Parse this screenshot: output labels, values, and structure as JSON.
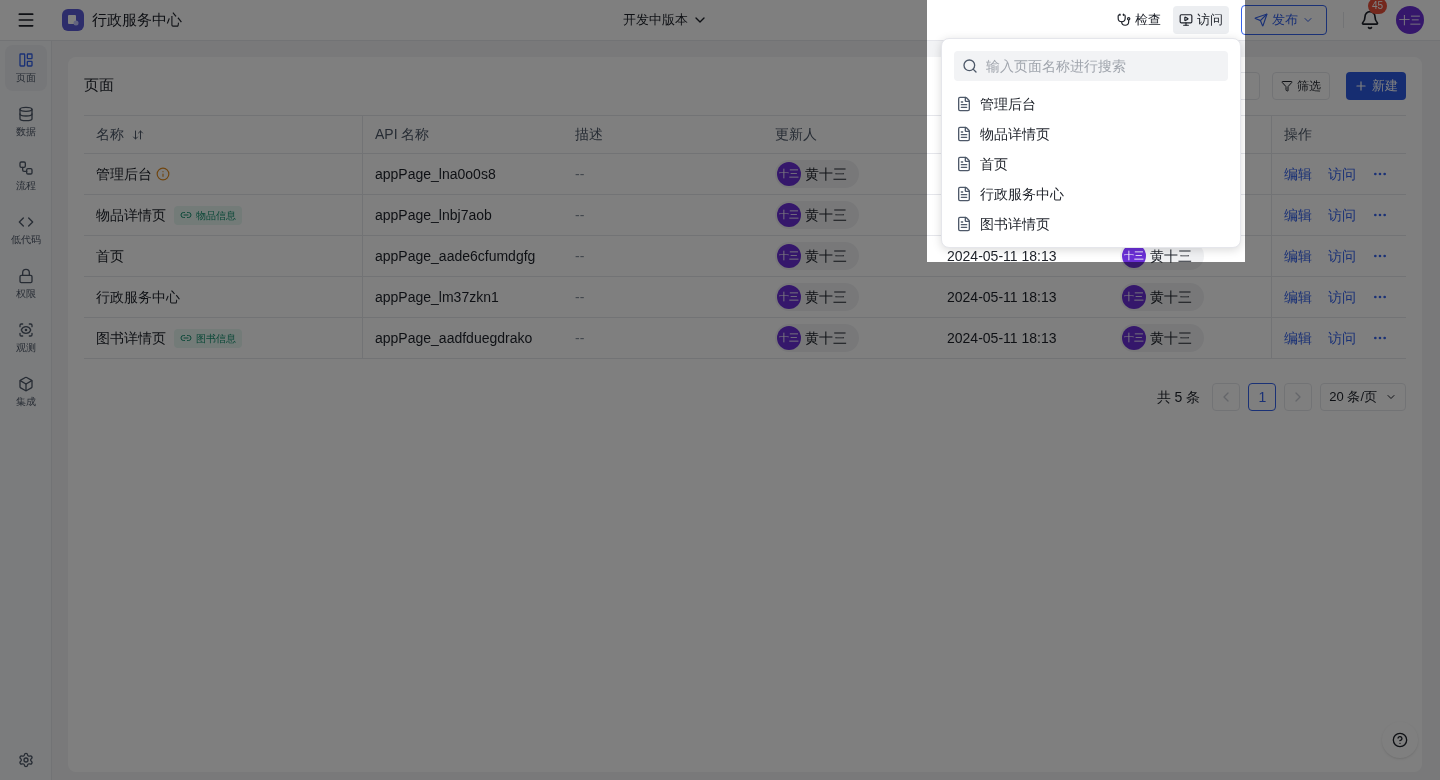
{
  "header": {
    "app_title": "行政服务中心",
    "version": "开发中版本",
    "inspect": "检查",
    "visit": {
      "label": "访问",
      "selected": true
    },
    "publish": "发布",
    "notifications": "45",
    "avatar": "十三"
  },
  "sidebar": {
    "items": [
      {
        "label": "页面",
        "selected": true
      },
      {
        "label": "数据",
        "selected": false
      },
      {
        "label": "流程",
        "selected": false
      },
      {
        "label": "低代码",
        "selected": false
      },
      {
        "label": "权限",
        "selected": false
      },
      {
        "label": "观测",
        "selected": false
      },
      {
        "label": "集成",
        "selected": false
      }
    ]
  },
  "page": {
    "title": "页面",
    "filter": "筛选",
    "create": "新建",
    "header": {
      "name": "名称",
      "api": "API 名称",
      "description": "描述",
      "updater": "更新人",
      "actions": "操作"
    },
    "rows": [
      {
        "name": "管理后台",
        "info": true,
        "api": "appPage_lna0o0s8",
        "description": "--",
        "updater": {
          "avatar": "十三",
          "name": "黄十三"
        },
        "actions": [
          "编辑",
          "访问"
        ]
      },
      {
        "name": "物品详情页",
        "info": false,
        "tag": "物品信息",
        "api": "appPage_lnbj7aob",
        "description": "--",
        "updater": {
          "avatar": "十三",
          "name": "黄十三"
        },
        "actions": [
          "编辑",
          "访问"
        ]
      },
      {
        "name": "首页",
        "info": false,
        "api": "appPage_aade6cfumdgfg",
        "description": "--",
        "updater": {
          "avatar": "十三",
          "name": "黄十三"
        },
        "column_5": "2024-05-11 18:13",
        "column_6": {
          "avatar": "十三",
          "name": "黄十三"
        },
        "actions": [
          "编辑",
          "访问"
        ]
      },
      {
        "name": "行政服务中心",
        "info": false,
        "api": "appPage_lm37zkn1",
        "description": "--",
        "updater": {
          "avatar": "十三",
          "name": "黄十三"
        },
        "column_5": "2024-05-11 18:13",
        "column_6": {
          "avatar": "十三",
          "name": "黄十三"
        },
        "actions": [
          "编辑",
          "访问"
        ]
      },
      {
        "name": "图书详情页",
        "info": false,
        "tag": "图书信息",
        "api": "appPage_aadfduegdrako",
        "description": "--",
        "updater": {
          "avatar": "十三",
          "name": "黄十三"
        },
        "column_5": "2024-05-11 18:13",
        "column_6": {
          "avatar": "十三",
          "name": "黄十三"
        },
        "actions": [
          "编辑",
          "访问"
        ]
      }
    ],
    "pagination": {
      "total": "共 5 条",
      "pages": [
        {
          "label": "1",
          "selected": true
        }
      ],
      "page_size": "20 条/页"
    }
  },
  "dropdown": {
    "placeholder": "输入页面名称进行搜索",
    "items": [
      "管理后台",
      "物品详情页",
      "首页",
      "行政服务中心",
      "图书详情页"
    ]
  }
}
